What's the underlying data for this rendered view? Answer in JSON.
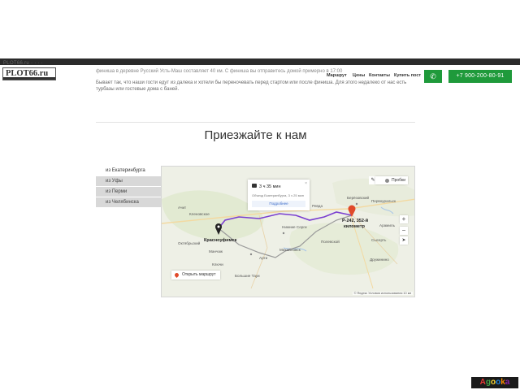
{
  "header": {
    "strip_text": "PLOT66.ru        ·   ·   ·   ·",
    "logo": "PLOT66.ru",
    "nav": [
      "Маршрут",
      "Цены",
      "Контакты",
      "Купить пост"
    ],
    "phone": "+7 900-200-80-91",
    "icon_button": "whatsapp-icon"
  },
  "intro": {
    "line1": "финиша в деревне Русский Усть-Маш составляет 40 км. С финиша вы отправитесь домой примерно в 17:00",
    "line2": "Бывает так, что наши гости едут из далека и хотели бы переночевать перед стартом или после финиша. Для этого недалеко от нас есть",
    "line3": "турбазы или гостевые дома с баней."
  },
  "section": {
    "title": "Приезжайте к нам"
  },
  "tabs": [
    {
      "label": "из Екатеринбурга",
      "active": true
    },
    {
      "label": "из Уфы",
      "active": false
    },
    {
      "label": "из Перми",
      "active": false
    },
    {
      "label": "из Челябинска",
      "active": false
    }
  ],
  "map": {
    "route_popup": {
      "time": "3 ч 35 мин",
      "sub": "Объезд Екатеринбурга, 3 ч 25 мин",
      "more": "Подробнее",
      "close": "×"
    },
    "traffic": "Пробки",
    "open_route": "Открыть маршрут",
    "dest_label": "Красноуфимск",
    "start_label_1": "Р-242, 352-й",
    "start_label_2": "километр",
    "labels": [
      "Ачит",
      "Бисерть",
      "Нижние Серги",
      "Михайловск",
      "Арти",
      "Дружинино",
      "Ревда",
      "Полевской",
      "Сысерть",
      "Кленовское",
      "Манчаж",
      "Большие Тауи",
      "Октябрьский",
      "Первоуральск",
      "Берёзовский",
      "Арамиль",
      "Ключи"
    ],
    "copyright": "© Яндекс  Условия использования   10 км",
    "zoom_in": "+",
    "zoom_out": "−",
    "colors": {
      "route": "#7a3fd0",
      "alt_route": "#9a9a9a",
      "pin": "#e04a2a",
      "marker": "#222222"
    }
  },
  "watermark": "Agooka"
}
